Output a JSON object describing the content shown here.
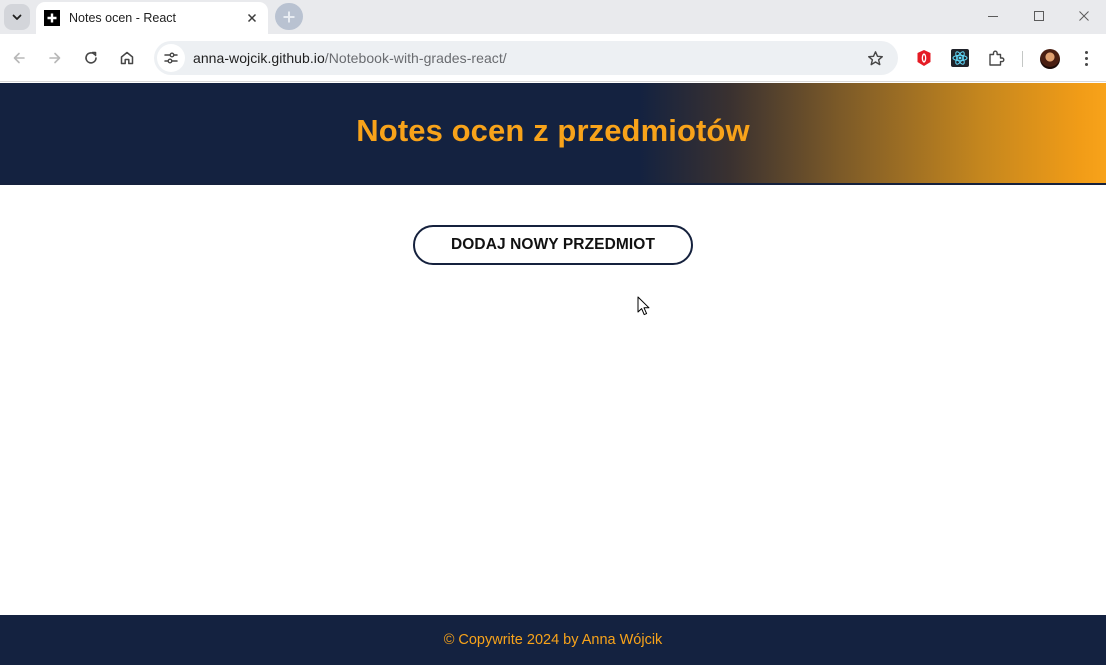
{
  "browser": {
    "tab": {
      "title": "Notes ocen - React",
      "favicon": "plus-icon"
    },
    "url_host": "anna-wojcik.github.io",
    "url_path": "/Notebook-with-grades-react/",
    "icons": [
      "tab-search-icon",
      "close-icon",
      "new-tab-icon",
      "minimize-icon",
      "maximize-icon",
      "window-close-icon",
      "back-icon",
      "forward-icon",
      "reload-icon",
      "home-icon",
      "site-info-icon",
      "bookmark-star-icon",
      "opera-extension-icon",
      "react-devtools-icon",
      "extensions-puzzle-icon",
      "profile-avatar",
      "menu-dots-icon"
    ]
  },
  "page": {
    "header_title": "Notes ocen z przedmiotów",
    "add_subject_button": "DODAJ NOWY PRZEDMIOT",
    "footer_text": "© Copywrite 2024 by Anna Wójcik"
  },
  "colors": {
    "header_bg": "#142240",
    "accent_orange": "#f8a31a",
    "button_border": "#15213d"
  }
}
